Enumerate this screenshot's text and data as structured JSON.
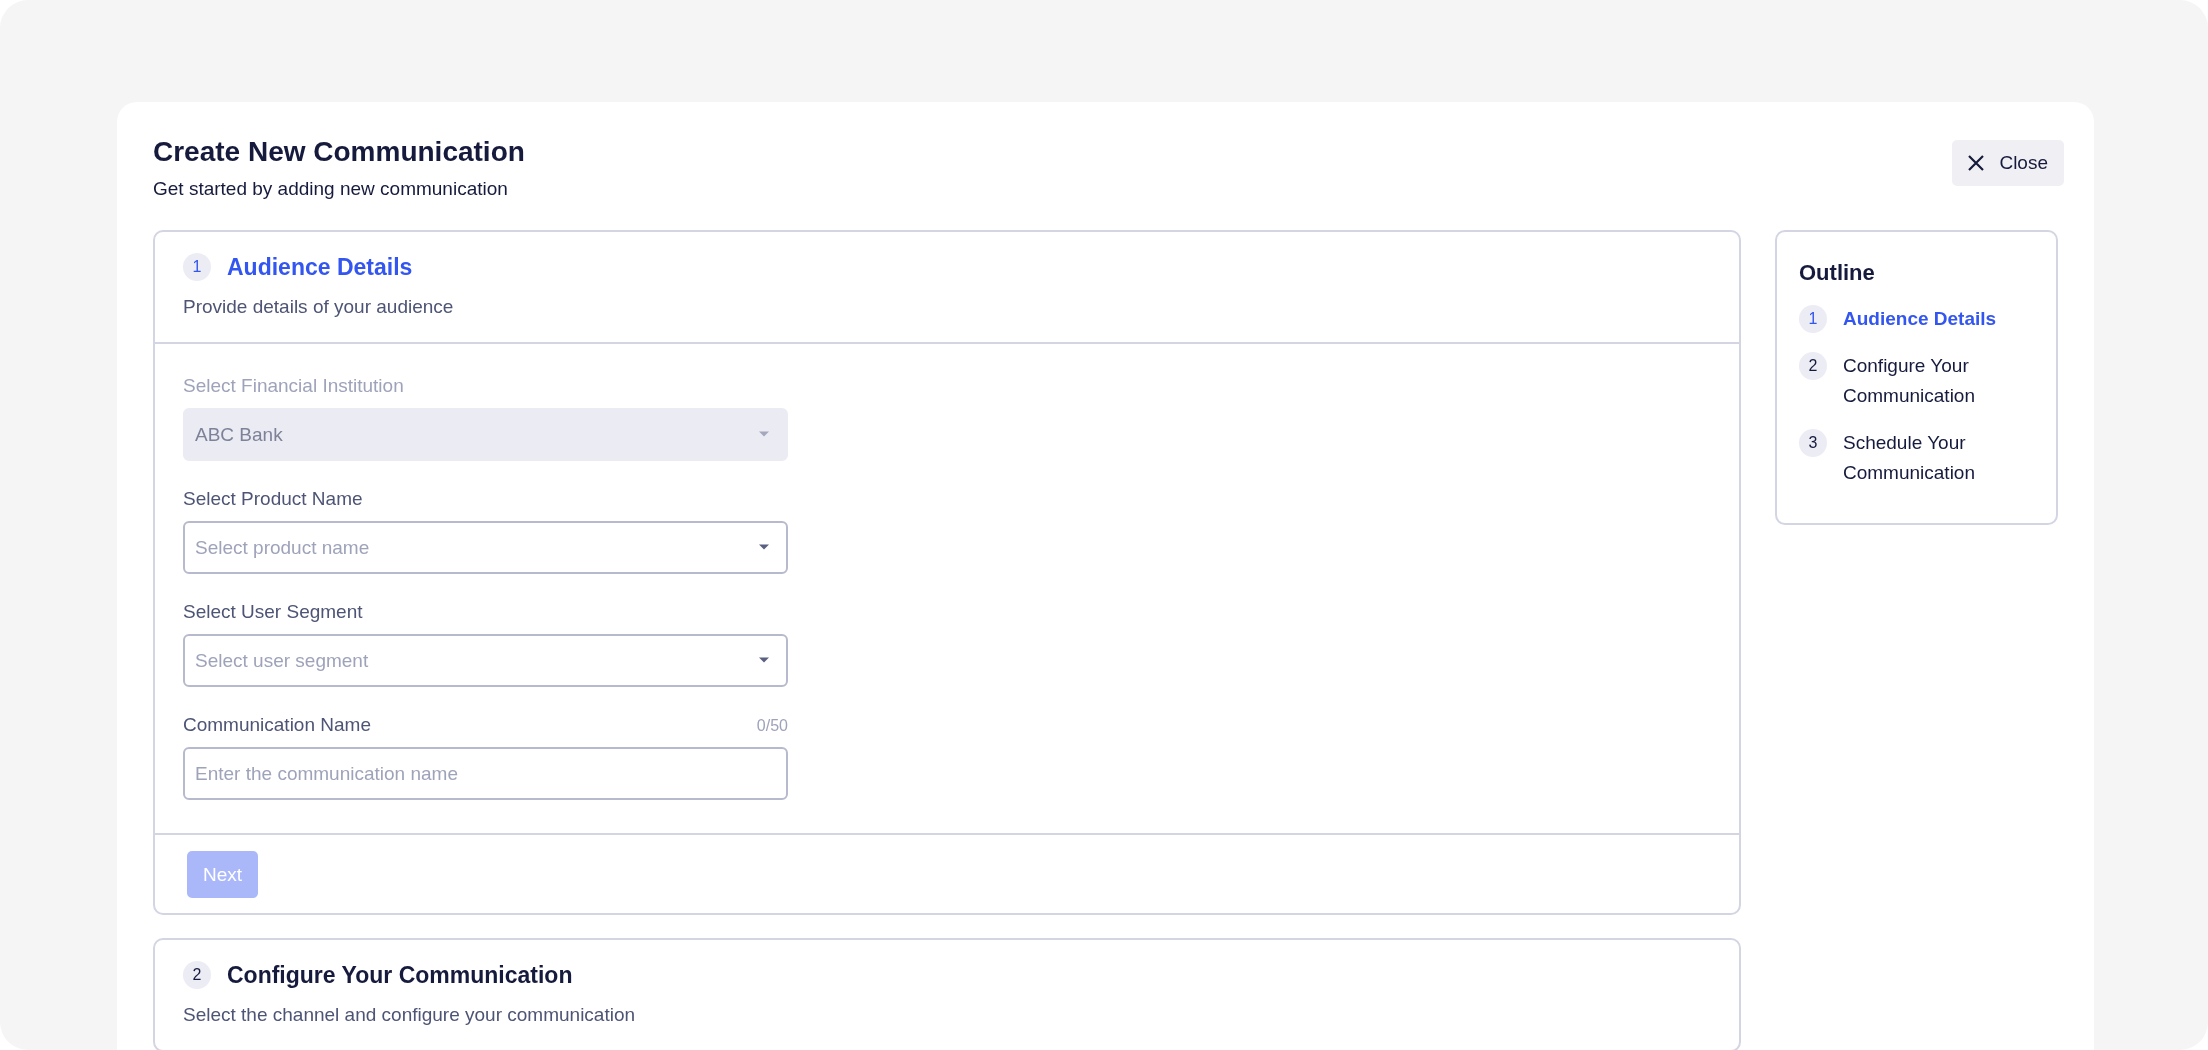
{
  "page": {
    "title": "Create New Communication",
    "subtitle": "Get started by adding new communication",
    "close_button": "Close"
  },
  "steps": [
    {
      "number": "1",
      "title": "Audience Details",
      "subtitle": "Provide details of your audience",
      "active": true,
      "fields": [
        {
          "kind": "select",
          "label": "Select Financial Institution",
          "value": "ABC Bank",
          "disabled": true
        },
        {
          "kind": "select",
          "label": "Select Product Name",
          "placeholder": "Select product name",
          "disabled": false
        },
        {
          "kind": "select",
          "label": "Select User Segment",
          "placeholder": "Select user segment",
          "disabled": false
        },
        {
          "kind": "text",
          "label": "Communication Name",
          "counter": "0/50",
          "placeholder": "Enter the communication name",
          "disabled": false
        }
      ],
      "next_button": {
        "label": "Next",
        "disabled": true
      }
    },
    {
      "number": "2",
      "title": "Configure Your Communication",
      "subtitle": "Select the channel and configure your communication",
      "active": false
    }
  ],
  "outline": {
    "title": "Outline",
    "items": [
      {
        "number": "1",
        "label": "Audience Details",
        "selected": true
      },
      {
        "number": "2",
        "label": "Configure Your Communication",
        "selected": false
      },
      {
        "number": "3",
        "label": "Schedule Your Communication",
        "selected": false
      }
    ]
  }
}
